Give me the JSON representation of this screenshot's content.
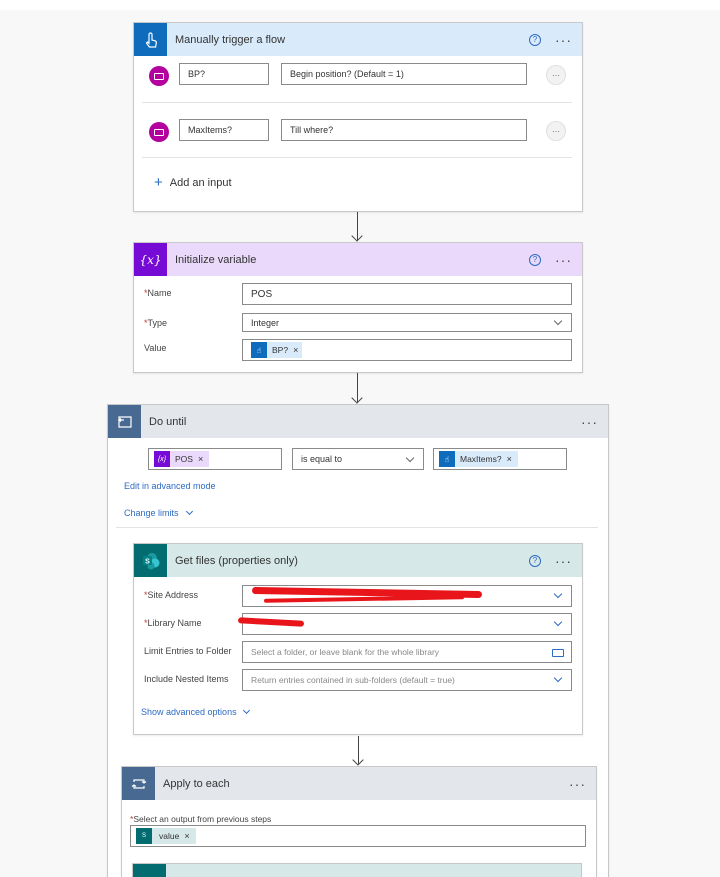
{
  "trigger": {
    "title": "Manually trigger a flow",
    "inputs": [
      {
        "name": "BP?",
        "description": "Begin position? (Default = 1)"
      },
      {
        "name": "MaxItems?",
        "description": "Till where?"
      }
    ],
    "add_input": "Add an input",
    "more": "···"
  },
  "init_var": {
    "title": "Initialize variable",
    "name_label": "Name",
    "name_value": "POS",
    "type_label": "Type",
    "type_value": "Integer",
    "value_label": "Value",
    "value_token": "BP?"
  },
  "do_until": {
    "title": "Do until",
    "left_token": "POS",
    "operator": "is equal to",
    "right_token": "MaxItems?",
    "edit_advanced": "Edit in advanced mode",
    "change_limits": "Change limits"
  },
  "get_files": {
    "title": "Get files (properties only)",
    "site_label": "Site Address",
    "library_label": "Library Name",
    "limit_label": "Limit Entries to Folder",
    "limit_placeholder": "Select a folder, or leave blank for the whole library",
    "nested_label": "Include Nested Items",
    "nested_placeholder": "Return entries contained in sub-folders (default = true)",
    "advanced": "Show advanced options"
  },
  "apply_each": {
    "title": "Apply to each",
    "select_label": "Select an output from previous steps",
    "token": "value"
  },
  "colors": {
    "trigger": "#0f6cbd",
    "trigger_head": "#d9eafa",
    "variable": "#770bd6",
    "variable_head": "#ead9fa",
    "control": "#486991",
    "control_head": "#e3e7ec",
    "sharepoint": "#036c70",
    "sharepoint_head": "#d7e8e8"
  }
}
